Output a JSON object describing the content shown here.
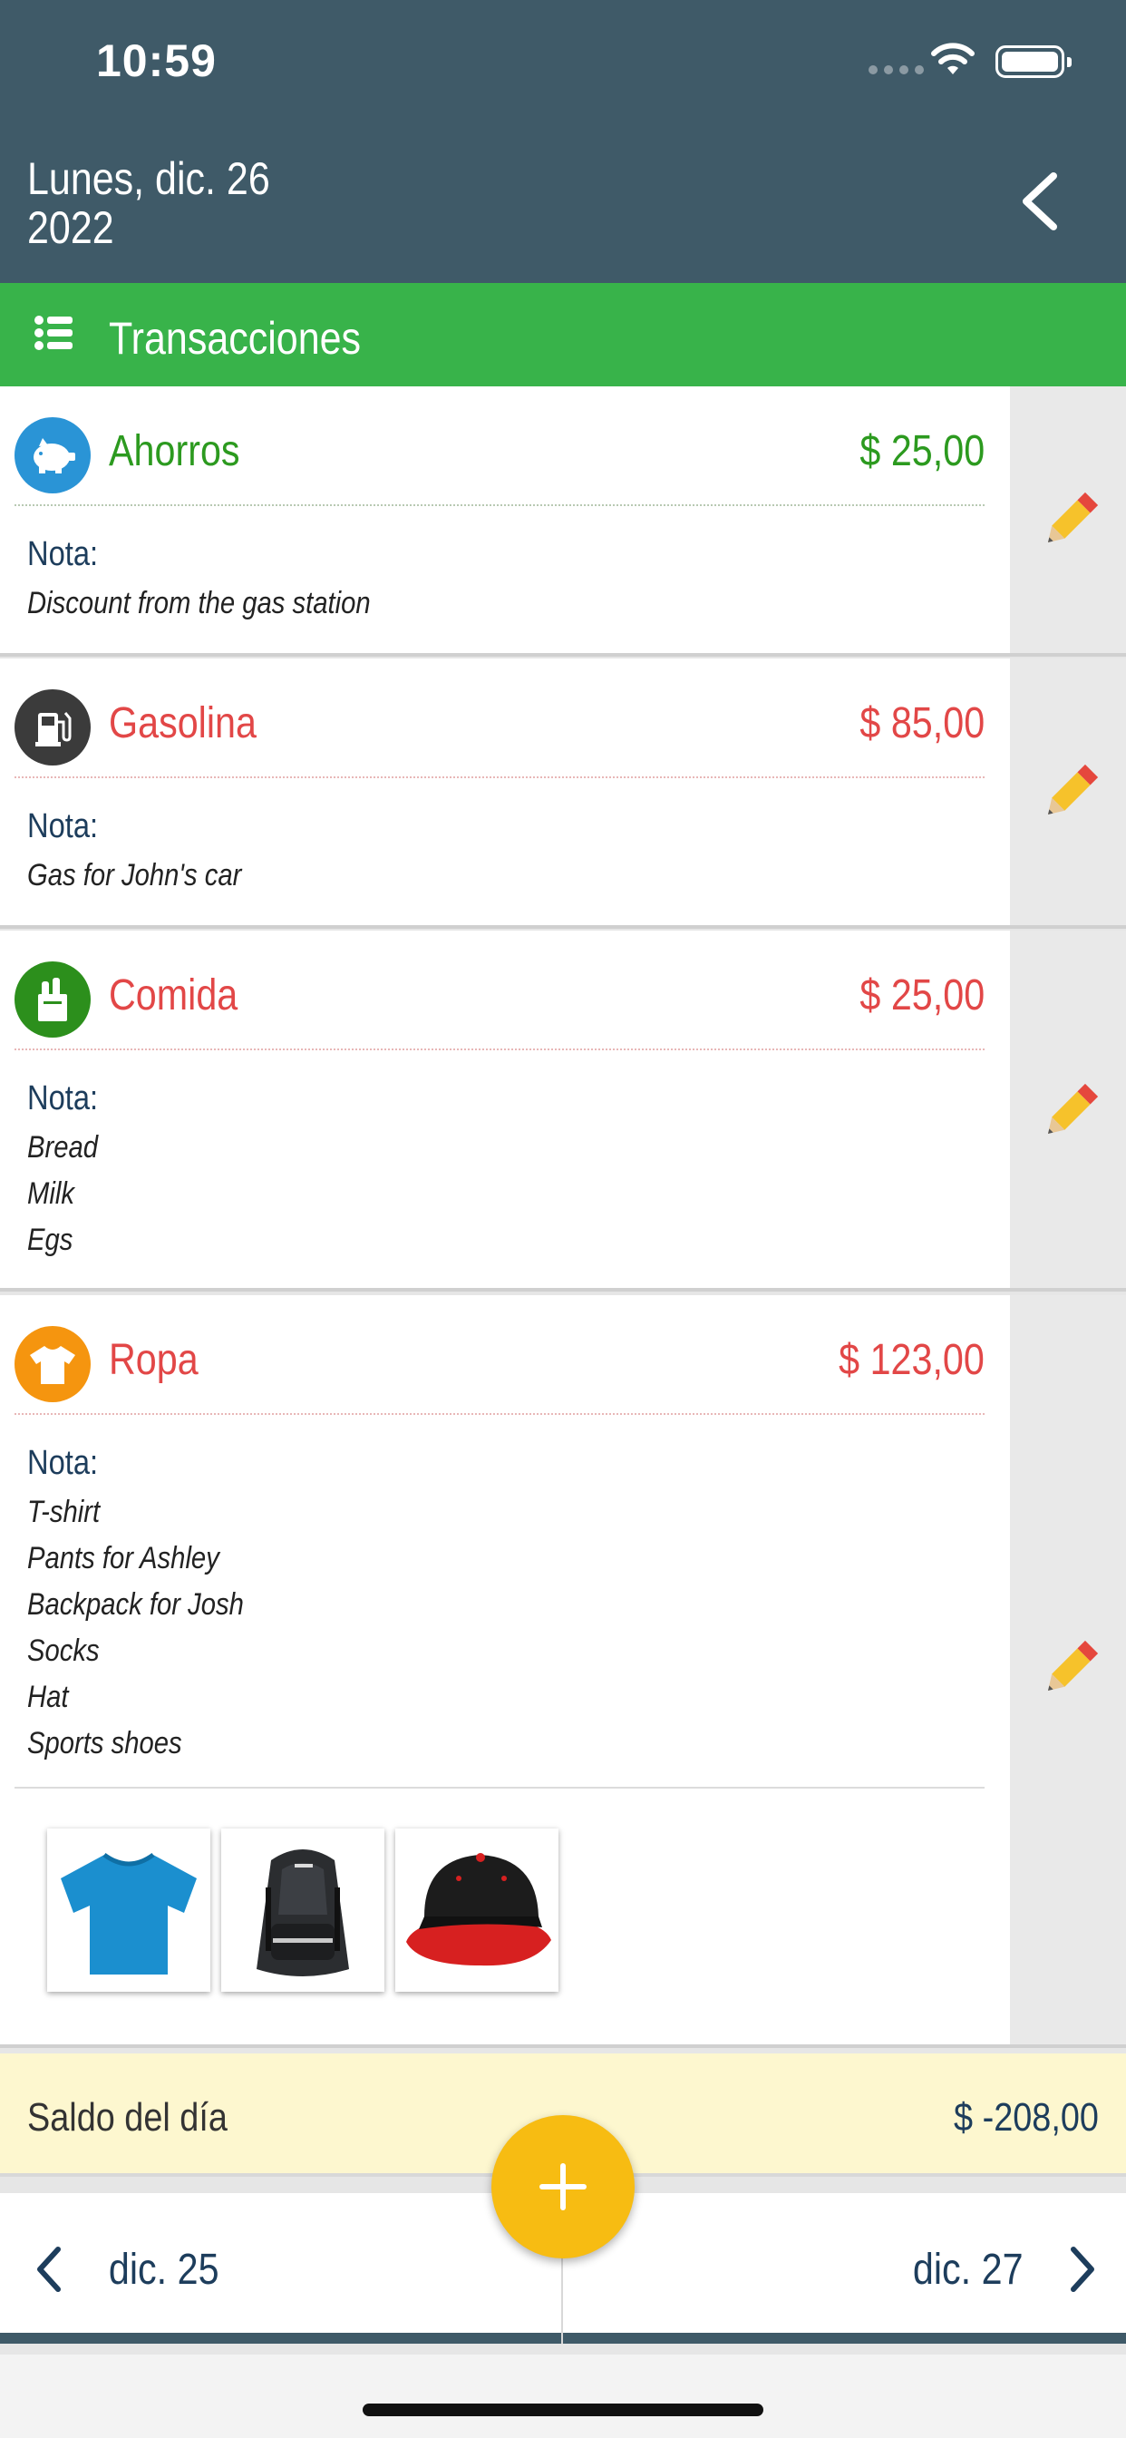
{
  "status_bar": {
    "time": "10:59"
  },
  "header": {
    "date_line1": "Lunes, dic. 26",
    "date_line2": "2022",
    "back_icon": "chevron-left-icon"
  },
  "section": {
    "title": "Transacciones",
    "icon": "list-icon"
  },
  "nota_label": "Nota:",
  "transactions": [
    {
      "category": "Ahorros",
      "amount": "$ 25,00",
      "type": "income",
      "color": "#2c9a1f",
      "icon": "piggy-bank-icon",
      "icon_bg": "#2a94d6",
      "note_lines": [
        "Discount from the gas station"
      ]
    },
    {
      "category": "Gasolina",
      "amount": "$ 85,00",
      "type": "expense",
      "color": "#e24747",
      "icon": "fuel-pump-icon",
      "icon_bg": "#3b3b3b",
      "note_lines": [
        "Gas for John's car"
      ]
    },
    {
      "category": "Comida",
      "amount": "$ 25,00",
      "type": "expense",
      "color": "#e24747",
      "icon": "grocery-bag-icon",
      "icon_bg": "#2c8f1c",
      "note_lines": [
        "Bread",
        "Milk",
        "Egs"
      ]
    },
    {
      "category": "Ropa",
      "amount": "$ 123,00",
      "type": "expense",
      "color": "#e24747",
      "icon": "tshirt-icon",
      "icon_bg": "#f5950f",
      "note_lines": [
        "T-shirt",
        "Pants for Ashley",
        "Backpack for Josh",
        "Socks",
        "Hat",
        "Sports shoes"
      ],
      "attachments": [
        "blue-tshirt-photo",
        "black-backpack-photo",
        "black-red-cap-photo"
      ]
    }
  ],
  "saldo": {
    "label": "Saldo del día",
    "value": "$ -208,00"
  },
  "nav": {
    "prev_label": "dic. 25",
    "next_label": "dic. 27"
  },
  "colors": {
    "header": "#3f5a68",
    "section": "#38b34a",
    "fab": "#f7bc12",
    "saldo_bg": "#fdf7cf"
  }
}
